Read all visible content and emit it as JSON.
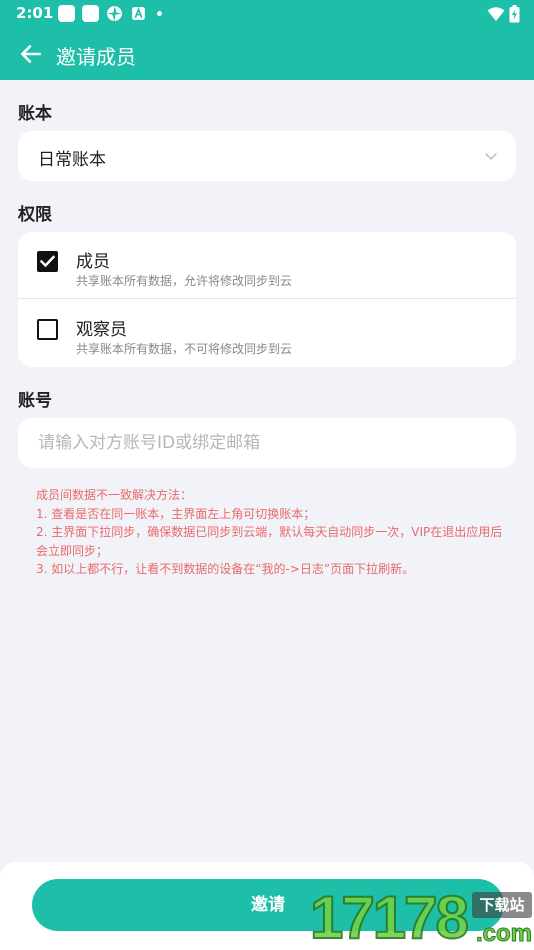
{
  "status_bar": {
    "time": "2:01"
  },
  "app_bar": {
    "title": "邀请成员"
  },
  "book_section": {
    "label": "账本",
    "selected": "日常账本"
  },
  "permission_section": {
    "label": "权限",
    "options": [
      {
        "title": "成员",
        "description": "共享账本所有数据，允许将修改同步到云",
        "checked": true
      },
      {
        "title": "观察员",
        "description": "共享账本所有数据，不可将修改同步到云",
        "checked": false
      }
    ]
  },
  "account_section": {
    "label": "账号",
    "placeholder": "请输入对方账号ID或绑定邮箱"
  },
  "notes": [
    "成员间数据不一致解决方法：",
    "1. 查看是否在同一账本，主界面左上角可切换账本；",
    "2. 主界面下拉同步，确保数据已同步到云端，默认每天自动同步一次，VIP在退出应用后会立即同步；",
    "3. 如以上都不行，让看不到数据的设备在“我的->日志”页面下拉刷新。"
  ],
  "invite_button": {
    "label": "邀请"
  },
  "watermark": {
    "logo": "17178",
    "tag": "下载站",
    "domain": ".com"
  },
  "colors": {
    "accent": "#1ebfa8",
    "note": "#e86a6a",
    "background": "#f1f3f8"
  }
}
